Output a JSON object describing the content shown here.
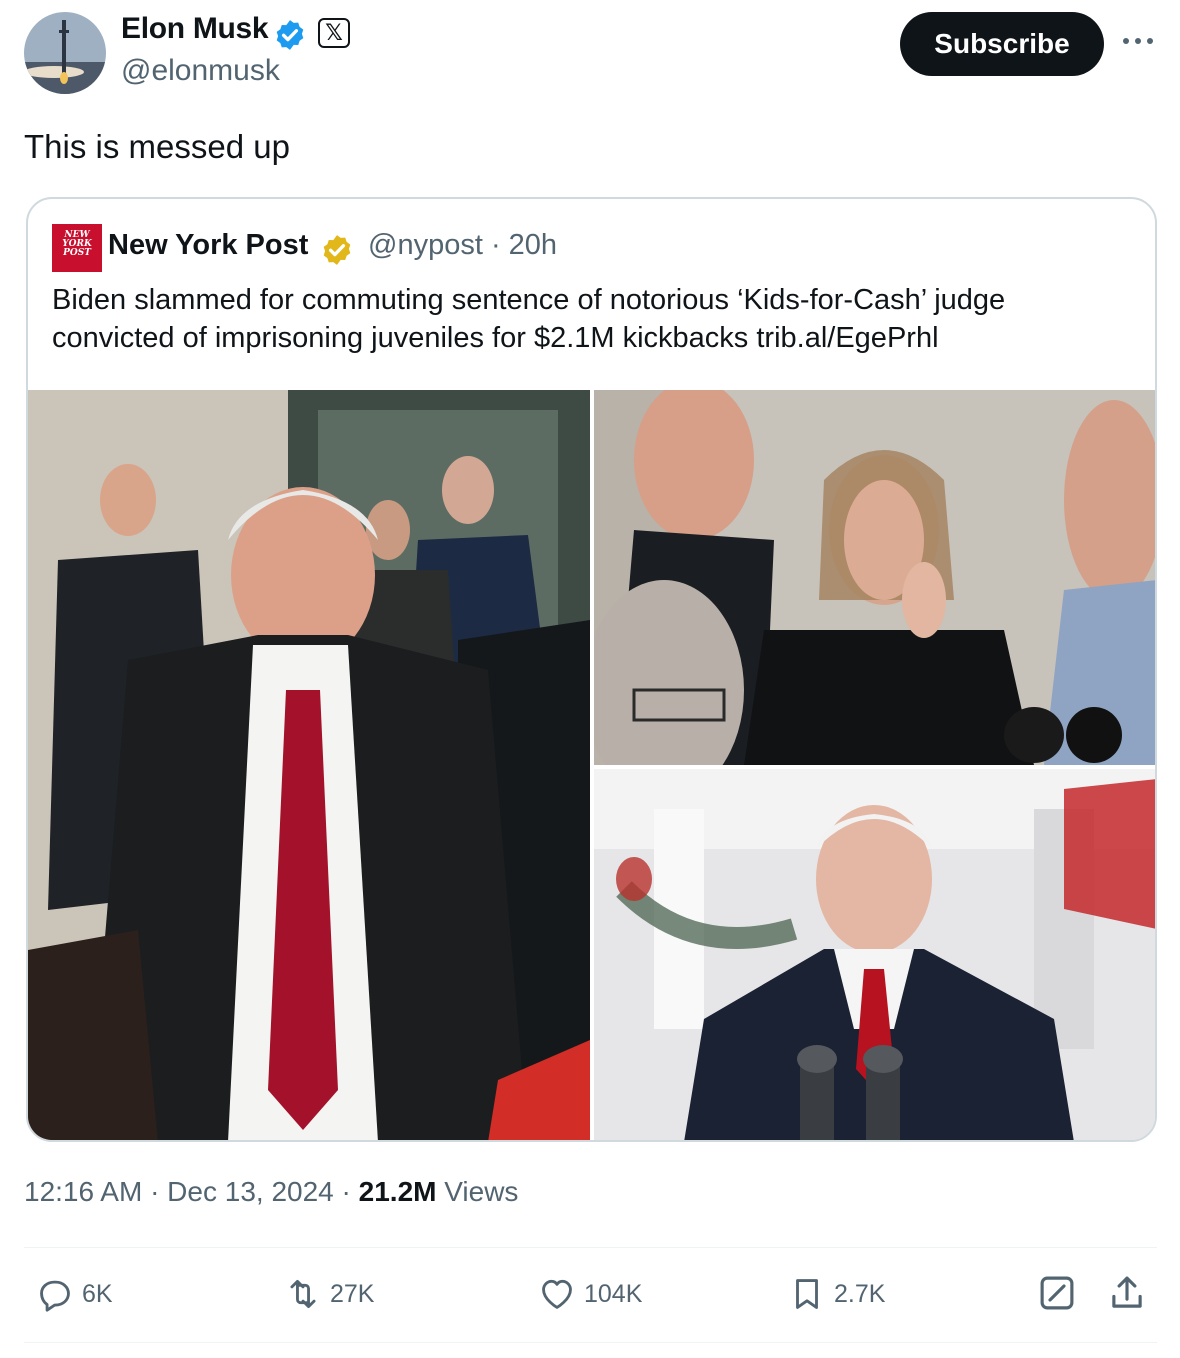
{
  "author": {
    "name": "Elon Musk",
    "handle": "@elonmusk",
    "x_badge": "𝕏",
    "avatar_icon": "rocket-launch-avatar-icon"
  },
  "header": {
    "subscribe_label": "Subscribe",
    "more_icon": "more-dots-icon"
  },
  "tweet": {
    "text": "This is messed up"
  },
  "quote": {
    "logo_text": "NEW YORK POST",
    "name": "New York Post",
    "handle_time": "@nypost · 20h",
    "text": "Biden slammed for commuting sentence of notorious ‘Kids-for-Cash’ judge convicted of imprisoning juveniles for $2.1M kickbacks trib.al/EgePrhl",
    "photos": [
      "judge-exiting-courthouse-photo",
      "angry-mother-photo",
      "biden-at-podium-photo"
    ]
  },
  "meta": {
    "time_date": "12:16 AM · Dec 13, 2024 · ",
    "views_count": "21.2M",
    "views_label": " Views"
  },
  "actions": {
    "reply": "6K",
    "retweet": "27K",
    "like": "104K",
    "bookmark": "2.7K"
  },
  "colors": {
    "verified_blue": "#1d9bf0",
    "verified_gold": "#e2b719",
    "nypost_red": "#c8102e",
    "text_primary": "#0f1419",
    "text_secondary": "#536471",
    "border": "#cfd9de"
  }
}
